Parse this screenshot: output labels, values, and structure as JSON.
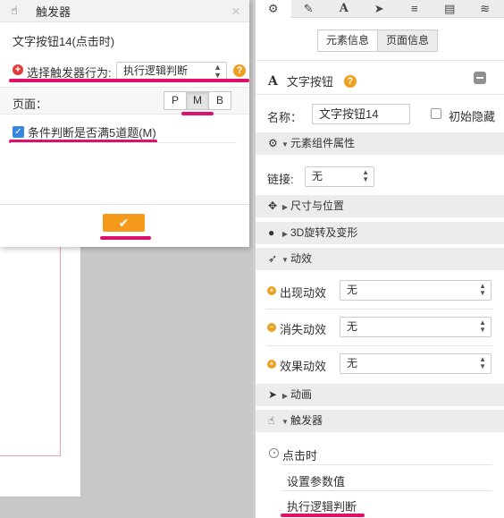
{
  "dialog": {
    "title": "触发器",
    "close": "×",
    "heading": "文字按钮14(点击时)",
    "behavior_label": "选择触发器行为:",
    "behavior_value": "执行逻辑判断",
    "help": "?",
    "page_label": "页面：",
    "page_buttons": [
      "P",
      "M",
      "B"
    ],
    "page_selected": "M",
    "condition_text": "条件判断是否满5道题(M)",
    "condition_checked": true,
    "ok_icon": "✔"
  },
  "panel": {
    "tabs": [
      "gear-icon",
      "pencil-icon",
      "font-icon",
      "send-icon",
      "list-icon",
      "file-icon",
      "database-icon"
    ],
    "tab_glyphs": [
      "⚙",
      "✎",
      "A",
      "➤",
      "≡",
      "▤",
      "≋"
    ],
    "segment": {
      "left": "元素信息",
      "right": "页面信息"
    },
    "element": {
      "icon": "A",
      "title": "文字按钮",
      "help": "?"
    },
    "name_label": "名称：",
    "name_value": "文字按钮14",
    "initial_hidden_label": "初始隐藏",
    "sections": {
      "component_props": "元素组件属性",
      "size_position": "尺寸与位置",
      "rotate_3d": "3D旋转及变形",
      "effects": "动效",
      "animation": "动画",
      "trigger": "触发器"
    },
    "link_label": "链接:",
    "link_value": "无",
    "effects_rows": [
      {
        "label": "出现动效",
        "value": "无"
      },
      {
        "label": "消失动效",
        "value": "无"
      },
      {
        "label": "效果动效",
        "value": "无"
      }
    ],
    "trigger_items": {
      "on_click": "点击时",
      "set_param": "设置参数值",
      "logic": "执行逻辑判断"
    }
  },
  "colors": {
    "highlight": "#e0106a",
    "accent_orange": "#f59a1b",
    "checkbox_blue": "#3a85e0",
    "plus_red": "#e23b3b"
  }
}
